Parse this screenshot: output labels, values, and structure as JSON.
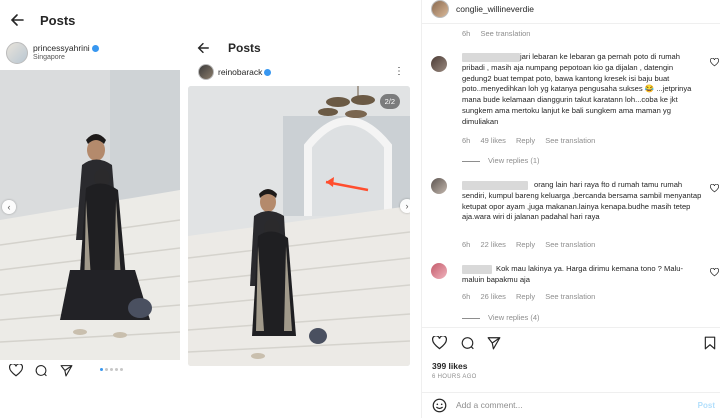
{
  "left": {
    "title": "Posts",
    "username": "princessyahrini",
    "location": "Singapore"
  },
  "middle": {
    "title": "Posts",
    "username": "reinobarack",
    "counter": "2/2",
    "more": "⋮"
  },
  "right": {
    "username": "conglie_willineverdie",
    "top_meta": {
      "time": "6h",
      "translate": "See translation"
    },
    "comments": [
      {
        "text": "jari lebaran ke lebaran ga pernah poto di rumah pribadi , masih aja numpang pepotoan kio ga dijalan , datengin gedung2 buat tempat poto, bawa kantong kresek isi baju buat poto..menyedihkan loh yg katanya pengusaha sukses 😂 ...jetprinya mana bude kelamaan dianggurin takut karatann loh...coba ke jkt sungkem ama mertoku lanjut ke bali sungkem ama maman yg dimuliakan",
        "time": "6h",
        "likes": "49 likes",
        "reply": "Reply",
        "translate": "See translation",
        "view_replies": "View replies (1)"
      },
      {
        "text": "orang lain hari raya fto d rumah tamu rumah sendiri, kumpul bareng keluarga ,bercanda bersama sambil menyantap ketupat opor ayam ,juga makanan.lainya kenapa.budhe masih tetep aja.wara wiri di jalanan padahal hari raya",
        "time": "6h",
        "likes": "22 likes",
        "reply": "Reply",
        "translate": "See translation",
        "view_replies": ""
      },
      {
        "text": "Kok mau lakinya ya. Harga dirimu kemana tono ? Malu-maluin bapakmu aja",
        "time": "6h",
        "likes": "26 likes",
        "reply": "Reply",
        "translate": "See translation",
        "view_replies": "View replies (4)"
      }
    ],
    "likes_count": "399 likes",
    "posted": "6 HOURS AGO",
    "add_comment_placeholder": "Add a comment...",
    "post_label": "Post"
  },
  "colors": {
    "link_blue": "#3897f0",
    "post_disabled": "#b2dffc",
    "muted": "#8e8e8e",
    "arrow_red": "#ff4e2e"
  }
}
